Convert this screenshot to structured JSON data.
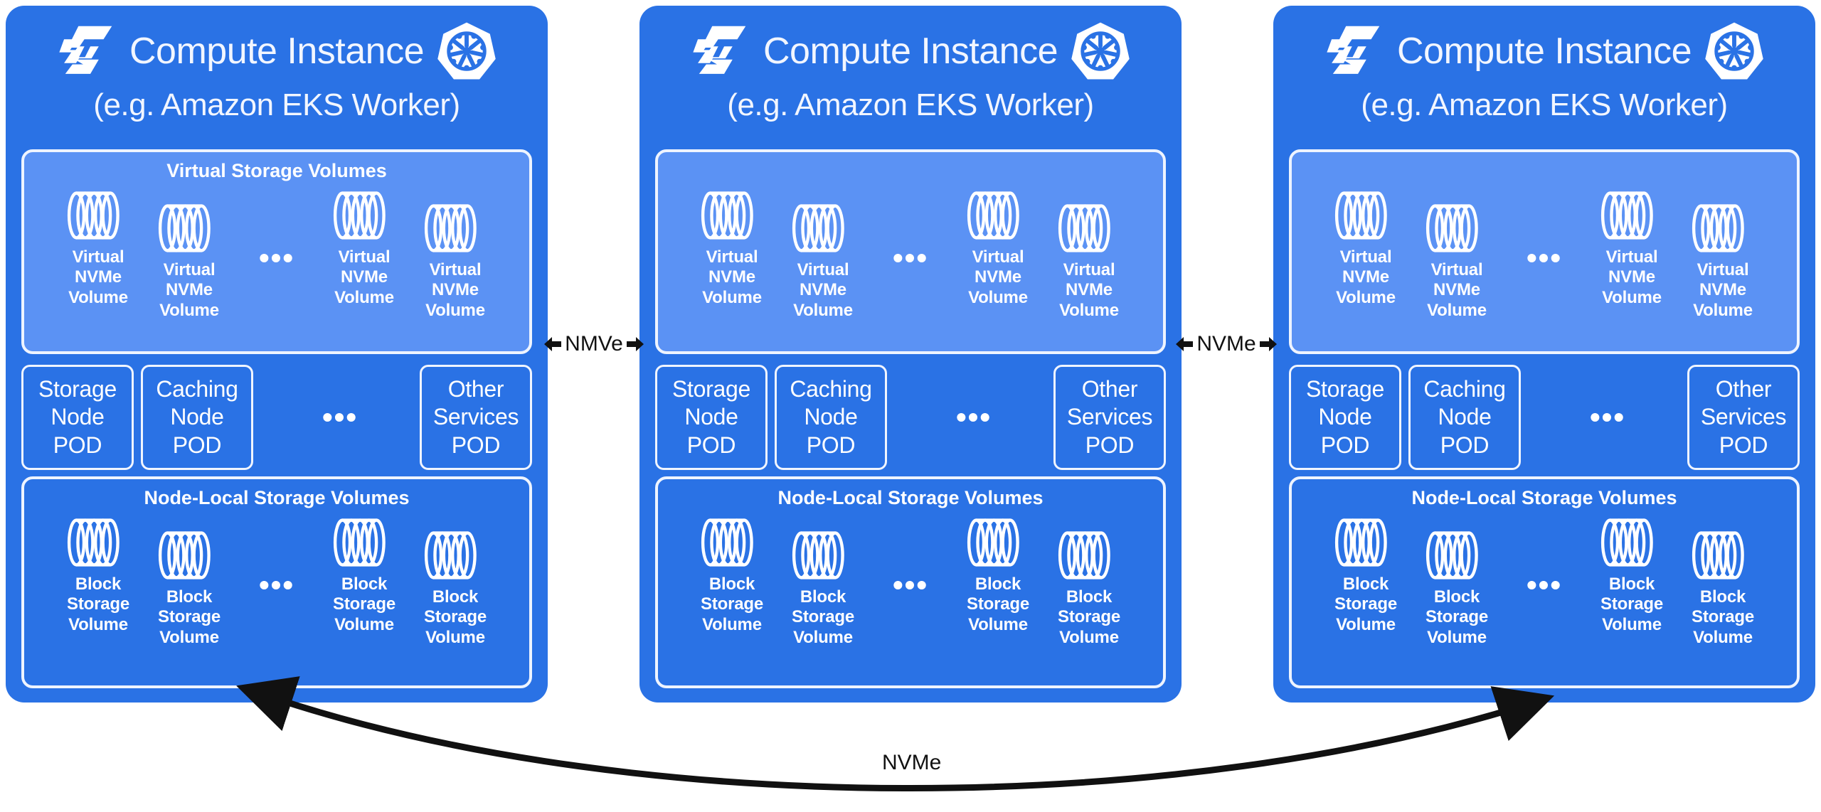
{
  "diagram": {
    "title": "Compute Instance NVMe Storage Architecture",
    "colors": {
      "card_blue": "#2a72e5",
      "panel_light_blue": "#5b92f4",
      "outline_white": "#eef4ff",
      "text_white": "#ffffff",
      "arrow_black": "#111111",
      "background": "#ffffff"
    },
    "instances": [
      {
        "logo_icon": "simplyblock-logo-icon",
        "kubernetes_icon": "kubernetes-logo-icon",
        "title": "Compute Instance",
        "subtitle": "(e.g. Amazon EKS Worker)",
        "virtual_storage": {
          "title": "Virtual Storage Volumes",
          "show_title": true,
          "volumes": [
            {
              "icon": "disk-stack-icon",
              "label": "Virtual\nNVMe\nVolume"
            },
            {
              "icon": "disk-stack-icon",
              "label": "Virtual\nNVMe\nVolume"
            },
            {
              "icon": "disk-stack-icon",
              "label": "Virtual\nNVMe\nVolume"
            },
            {
              "icon": "disk-stack-icon",
              "label": "Virtual\nNVMe\nVolume"
            }
          ],
          "ellipsis": "•••"
        },
        "pods": [
          {
            "label": "Storage\nNode\nPOD"
          },
          {
            "label": "Caching\nNode\nPOD"
          },
          {
            "label": "Other\nServices\nPOD"
          }
        ],
        "pods_ellipsis": "•••",
        "node_local_storage": {
          "title": "Node-Local Storage Volumes",
          "show_title": true,
          "volumes": [
            {
              "icon": "disk-stack-icon",
              "label": "Block\nStorage\nVolume"
            },
            {
              "icon": "disk-stack-icon",
              "label": "Block\nStorage\nVolume"
            },
            {
              "icon": "disk-stack-icon",
              "label": "Block\nStorage\nVolume"
            },
            {
              "icon": "disk-stack-icon",
              "label": "Block\nStorage\nVolume"
            }
          ],
          "ellipsis": "•••"
        }
      },
      {
        "logo_icon": "simplyblock-logo-icon",
        "kubernetes_icon": "kubernetes-logo-icon",
        "title": "Compute Instance",
        "subtitle": "(e.g. Amazon EKS Worker)",
        "virtual_storage": {
          "title": "",
          "show_title": false,
          "volumes": [
            {
              "icon": "disk-stack-icon",
              "label": "Virtual\nNVMe\nVolume"
            },
            {
              "icon": "disk-stack-icon",
              "label": "Virtual\nNVMe\nVolume"
            },
            {
              "icon": "disk-stack-icon",
              "label": "Virtual\nNVMe\nVolume"
            },
            {
              "icon": "disk-stack-icon",
              "label": "Virtual\nNVMe\nVolume"
            }
          ],
          "ellipsis": "•••"
        },
        "pods": [
          {
            "label": "Storage\nNode\nPOD"
          },
          {
            "label": "Caching\nNode\nPOD"
          },
          {
            "label": "Other\nServices\nPOD"
          }
        ],
        "pods_ellipsis": "•••",
        "node_local_storage": {
          "title": "Node-Local Storage Volumes",
          "show_title": true,
          "volumes": [
            {
              "icon": "disk-stack-icon",
              "label": "Block\nStorage\nVolume"
            },
            {
              "icon": "disk-stack-icon",
              "label": "Block\nStorage\nVolume"
            },
            {
              "icon": "disk-stack-icon",
              "label": "Block\nStorage\nVolume"
            },
            {
              "icon": "disk-stack-icon",
              "label": "Block\nStorage\nVolume"
            }
          ],
          "ellipsis": "•••"
        }
      },
      {
        "logo_icon": "simplyblock-logo-icon",
        "kubernetes_icon": "kubernetes-logo-icon",
        "title": "Compute Instance",
        "subtitle": "(e.g. Amazon EKS Worker)",
        "virtual_storage": {
          "title": "",
          "show_title": false,
          "volumes": [
            {
              "icon": "disk-stack-icon",
              "label": "Virtual\nNVMe\nVolume"
            },
            {
              "icon": "disk-stack-icon",
              "label": "Virtual\nNVMe\nVolume"
            },
            {
              "icon": "disk-stack-icon",
              "label": "Virtual\nNVMe\nVolume"
            },
            {
              "icon": "disk-stack-icon",
              "label": "Virtual\nNVMe\nVolume"
            }
          ],
          "ellipsis": "•••"
        },
        "pods": [
          {
            "label": "Storage\nNode\nPOD"
          },
          {
            "label": "Caching\nNode\nPOD"
          },
          {
            "label": "Other\nServices\nPOD"
          }
        ],
        "pods_ellipsis": "•••",
        "node_local_storage": {
          "title": "Node-Local Storage Volumes",
          "show_title": true,
          "volumes": [
            {
              "icon": "disk-stack-icon",
              "label": "Block\nStorage\nVolume"
            },
            {
              "icon": "disk-stack-icon",
              "label": "Block\nStorage\nVolume"
            },
            {
              "icon": "disk-stack-icon",
              "label": "Block\nStorage\nVolume"
            },
            {
              "icon": "disk-stack-icon",
              "label": "Block\nStorage\nVolume"
            }
          ],
          "ellipsis": "•••"
        }
      }
    ],
    "connectors": [
      {
        "label": "NMVe",
        "left_arrow_icon": "arrow-left-icon",
        "right_arrow_icon": "arrow-right-icon"
      },
      {
        "label": "NVMe",
        "left_arrow_icon": "arrow-left-icon",
        "right_arrow_icon": "arrow-right-icon"
      }
    ],
    "bottom_link": {
      "label": "NVMe",
      "left_arrow_icon": "arrow-left-icon",
      "right_arrow_icon": "arrow-right-icon"
    }
  }
}
